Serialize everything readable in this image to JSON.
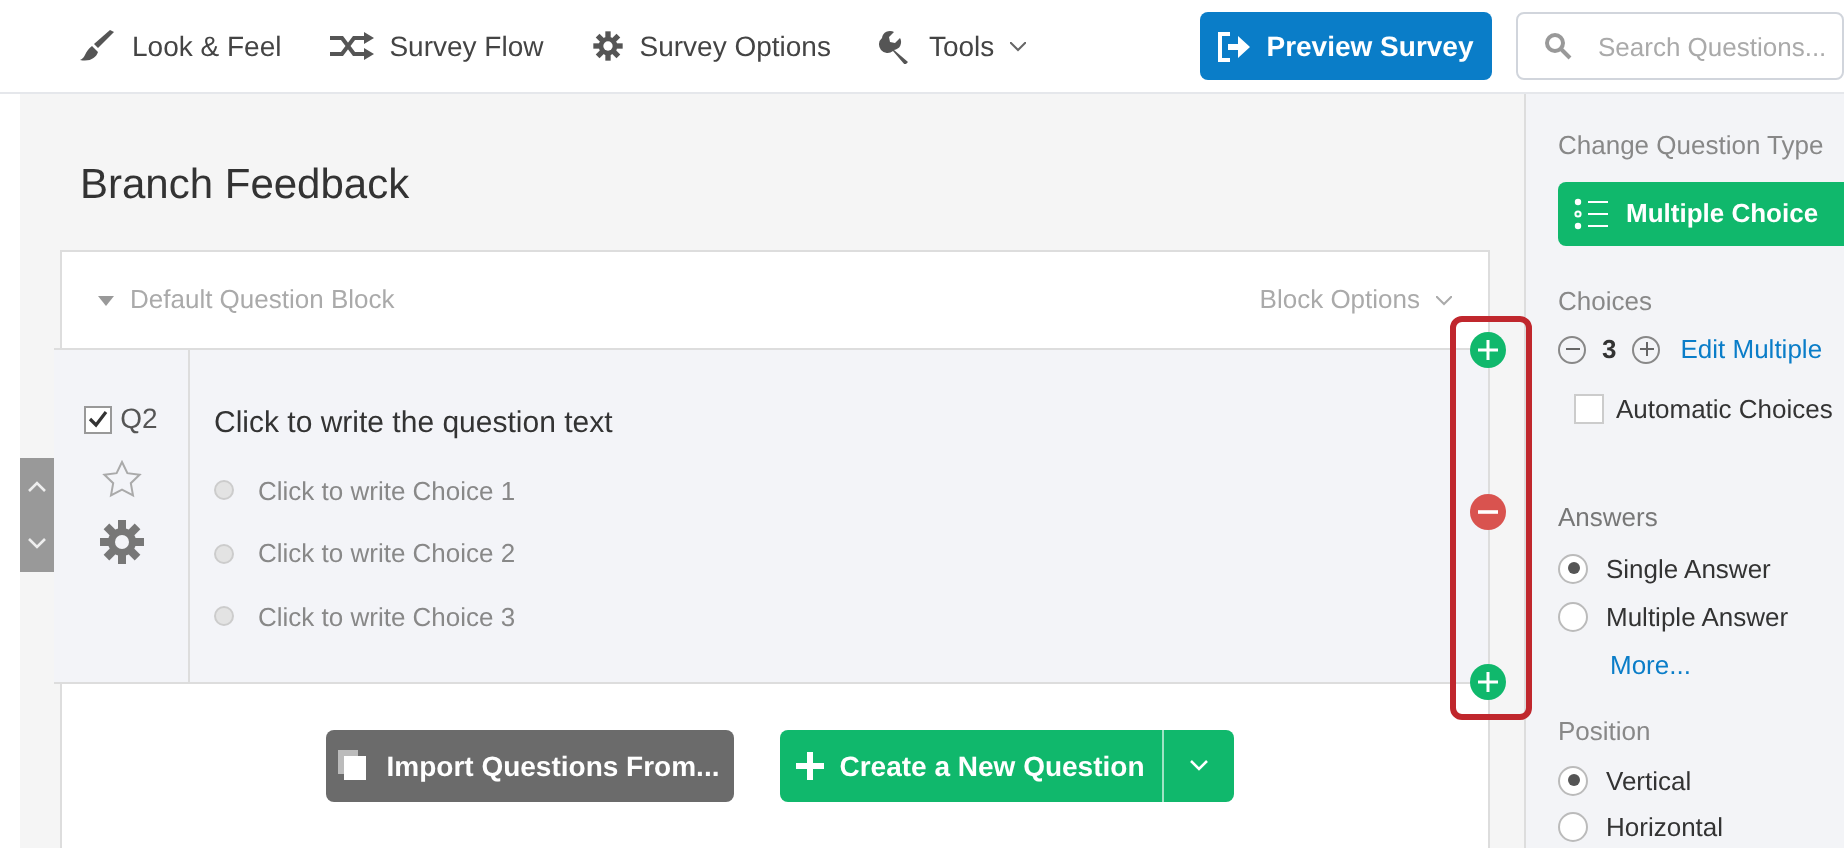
{
  "nav": [
    {
      "label": "Look & Feel",
      "kind": "brush"
    },
    {
      "label": "Survey Flow",
      "kind": "flow"
    },
    {
      "label": "Survey Options",
      "kind": "gear"
    },
    {
      "label": "Tools",
      "kind": "wrench",
      "dropdown": true
    }
  ],
  "preview_button": "Preview Survey",
  "search": {
    "placeholder": "Search Questions..."
  },
  "survey_title": "Branch Feedback",
  "block": {
    "name": "Default Question Block",
    "options_label": "Block Options"
  },
  "question": {
    "number": "Q2",
    "checked": true,
    "text": "Click to write the question text",
    "choices": [
      {
        "label": "Click to write Choice 1",
        "selected": false
      },
      {
        "label": "Click to write Choice 2",
        "selected": false
      },
      {
        "label": "Click to write Choice 3",
        "selected": false
      }
    ]
  },
  "side_controls": [
    {
      "kind": "add"
    },
    {
      "kind": "remove"
    },
    {
      "kind": "add"
    }
  ],
  "import_button": "Import Questions From...",
  "create_button": "Create a New Question",
  "panel": {
    "type_heading": "Change Question Type",
    "type_button": "Multiple Choice",
    "choices_heading": "Choices",
    "choice_count": "3",
    "edit_link": "Edit Multiple",
    "automatic": {
      "label": "Automatic Choices",
      "checked": false
    },
    "answers_heading": "Answers",
    "answers": [
      {
        "label": "Single Answer",
        "selected": true
      },
      {
        "label": "Multiple Answer",
        "selected": false
      }
    ],
    "more_link": "More...",
    "position_heading": "Position",
    "positions": [
      {
        "label": "Vertical",
        "selected": true
      },
      {
        "label": "Horizontal",
        "selected": false
      }
    ]
  }
}
